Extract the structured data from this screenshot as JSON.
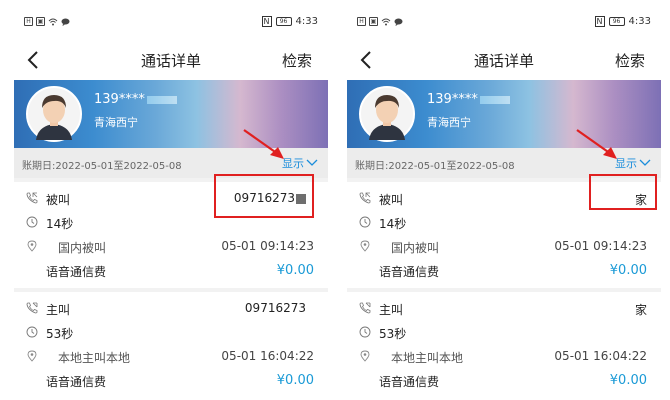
{
  "status": {
    "time": "4:33",
    "battery": "96"
  },
  "nav": {
    "title": "通话详单",
    "search": "检索"
  },
  "user": {
    "phone": "139****",
    "region": "青海西宁"
  },
  "period": {
    "label": "账期日:2022-05-01至2022-05-08",
    "show": "显示"
  },
  "left": {
    "records": [
      {
        "type": "被叫",
        "duration": "14秒",
        "category": "国内被叫",
        "datetime": "05-01 09:14:23",
        "fee_label": "语音通信费",
        "fee": "¥0.00",
        "number": "09716273"
      },
      {
        "type": "主叫",
        "duration": "53秒",
        "category": "本地主叫本地",
        "datetime": "05-01 16:04:22",
        "fee_label": "语音通信费",
        "fee": "¥0.00",
        "number": "09716273"
      }
    ]
  },
  "right": {
    "records": [
      {
        "type": "被叫",
        "duration": "14秒",
        "category": "国内被叫",
        "datetime": "05-01 09:14:23",
        "fee_label": "语音通信费",
        "fee": "¥0.00",
        "name": "家"
      },
      {
        "type": "主叫",
        "duration": "53秒",
        "category": "本地主叫本地",
        "datetime": "05-01 16:04:22",
        "fee_label": "语音通信费",
        "fee": "¥0.00",
        "name": "家"
      }
    ]
  },
  "colors": {
    "accent": "#1a8ddb",
    "highlight": "#e02020",
    "fee": "#1a9ad6"
  }
}
